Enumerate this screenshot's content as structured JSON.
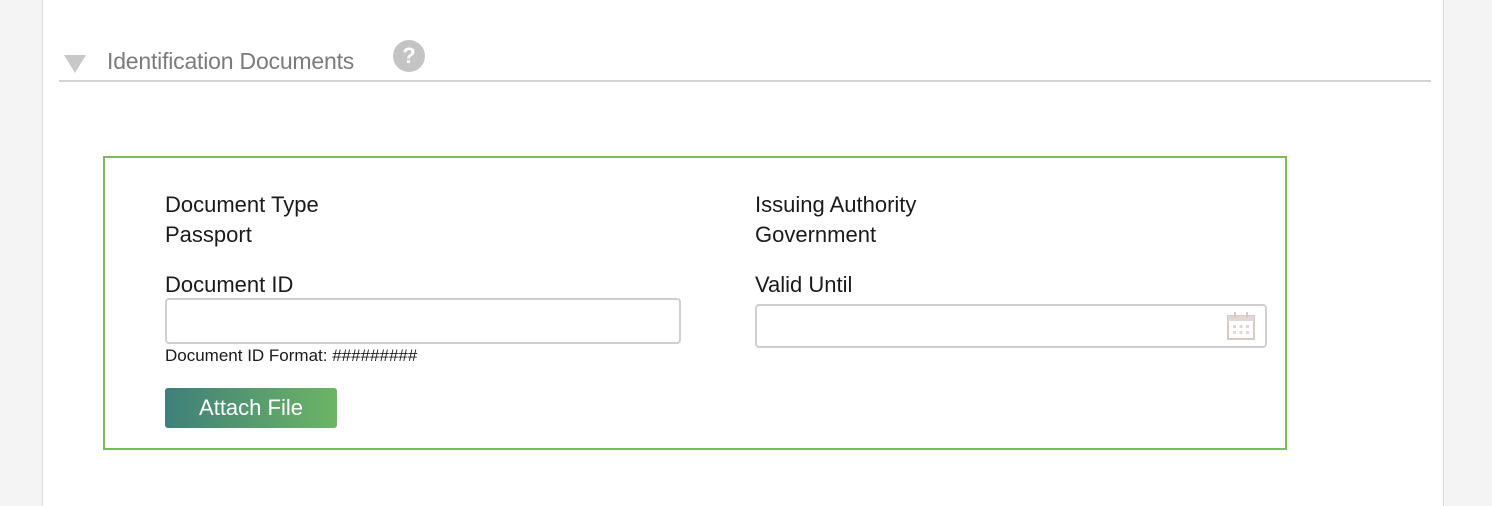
{
  "section": {
    "title": "Identification Documents",
    "help_glyph": "?",
    "collapse_icon": "triangle-down-icon"
  },
  "document": {
    "type_label": "Document Type",
    "type_value": "Passport",
    "authority_label": "Issuing Authority",
    "authority_value": "Government",
    "id_label": "Document ID",
    "id_value": "",
    "id_placeholder": "",
    "id_hint": "Document ID Format: #########",
    "valid_label": "Valid Until",
    "valid_value": "",
    "valid_placeholder": "",
    "attach_label": "Attach File"
  },
  "colors": {
    "card_border": "#7dbb5a",
    "button_gradient_start": "#3f7f7a",
    "button_gradient_end": "#6db565",
    "section_title": "#7b7b7b"
  }
}
